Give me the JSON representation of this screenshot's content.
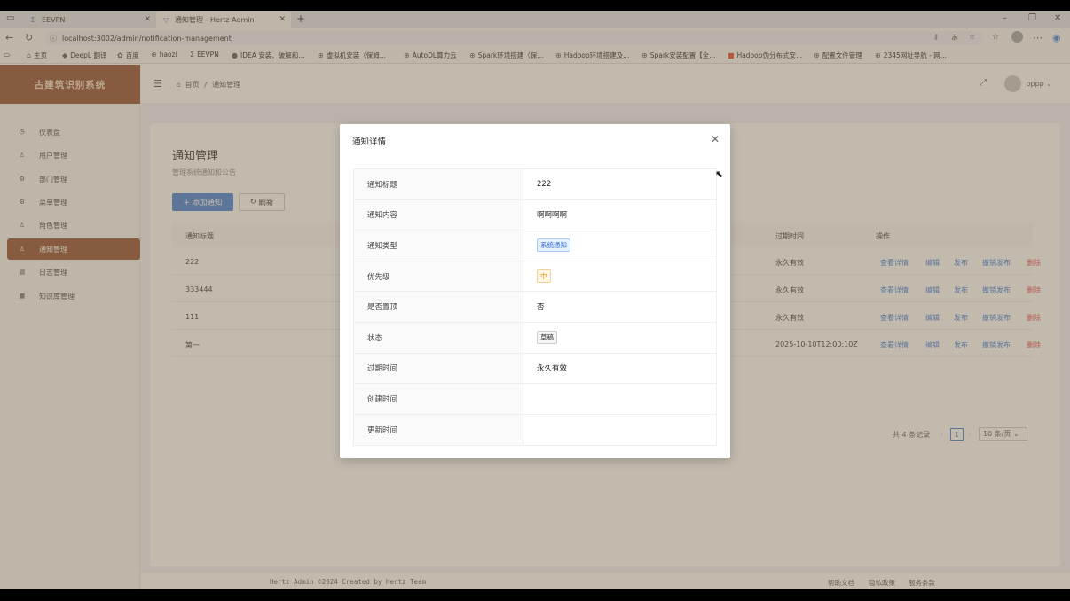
{
  "browser": {
    "tabs": [
      {
        "label": "EEVPN",
        "icon": "sigma-icon"
      },
      {
        "label": "通知管理 - Hertz Admin",
        "icon": "vite-icon"
      }
    ],
    "url": "localhost:3002/admin/notification-management",
    "bookmarks": [
      "主页",
      "DeepL 翻译",
      "百度",
      "haozi",
      "EEVPN",
      "IDEA 安装、破解和...",
      "虚拟机安装（保姆...",
      "AutoDL算力云",
      "Spark环境搭建（保...",
      "Hadoop环境搭建及...",
      "Spark安装配置【全...",
      "Hadoop伪分布式安...",
      "配置文件管理",
      "2345网址导航 - 网..."
    ]
  },
  "sidebar": {
    "brand": "古建筑识别系统",
    "items": [
      {
        "label": "仪表盘",
        "icon": "dashboard-icon"
      },
      {
        "label": "用户管理",
        "icon": "user-icon"
      },
      {
        "label": "部门管理",
        "icon": "gear-icon"
      },
      {
        "label": "菜单管理",
        "icon": "gear-icon"
      },
      {
        "label": "角色管理",
        "icon": "user-icon"
      },
      {
        "label": "通知管理",
        "icon": "user-icon",
        "active": true
      },
      {
        "label": "日志管理",
        "icon": "log-icon"
      },
      {
        "label": "知识库管理",
        "icon": "book-icon"
      }
    ]
  },
  "header": {
    "breadcrumb": "首页 / 通知管理",
    "username": "pppp"
  },
  "main": {
    "title": "通知管理",
    "subtitle": "管理系统通知和公告",
    "add_button": "+ 添加通知",
    "refresh_button": "刷新",
    "columns": {
      "title": "通知标题",
      "expire": "过期时间",
      "actions": "操作"
    },
    "rows": [
      {
        "title": "222",
        "expire": "永久有效"
      },
      {
        "title": "333444",
        "expire": "永久有效"
      },
      {
        "title": "111",
        "expire": "永久有效"
      },
      {
        "title": "第一",
        "expire": "2025-10-10T12:00:10Z"
      }
    ],
    "actions": {
      "view": "查看详情",
      "edit": "编辑",
      "publish": "发布",
      "unpublish": "撤销发布",
      "delete": "删除"
    },
    "pagination": {
      "total": "共 4 条记录",
      "current": "1",
      "page_size": "10 条/页"
    }
  },
  "footer": {
    "copyright": "Hertz Admin ©2024 Created by Hertz Team",
    "links": [
      "帮助文档",
      "隐私政策",
      "服务条款"
    ]
  },
  "modal": {
    "title": "通知详情",
    "fields": [
      {
        "label": "通知标题",
        "value": "222",
        "type": "text"
      },
      {
        "label": "通知内容",
        "value": "啊啊啊啊",
        "type": "text"
      },
      {
        "label": "通知类型",
        "value": "系统通知",
        "type": "tag-blue"
      },
      {
        "label": "优先级",
        "value": "中",
        "type": "tag-orange"
      },
      {
        "label": "是否置顶",
        "value": "否",
        "type": "text"
      },
      {
        "label": "状态",
        "value": "草稿",
        "type": "tag-gray"
      },
      {
        "label": "过期时间",
        "value": "永久有效",
        "type": "text"
      },
      {
        "label": "创建时间",
        "value": "",
        "type": "text"
      },
      {
        "label": "更新时间",
        "value": "",
        "type": "text"
      }
    ]
  }
}
